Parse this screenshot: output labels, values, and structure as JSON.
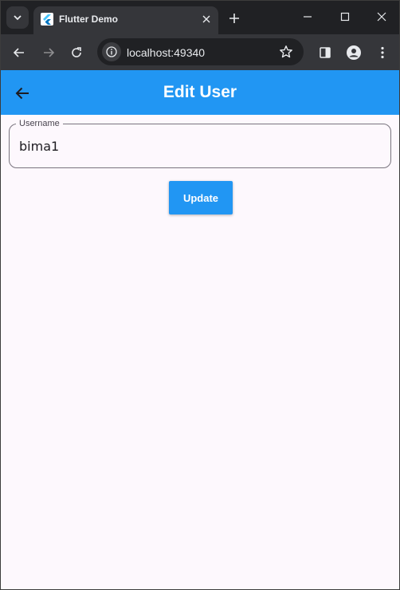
{
  "browser": {
    "tab_title": "Flutter Demo",
    "url": "localhost:49340"
  },
  "icons": {
    "tab_search": "chevron-down-icon",
    "favicon": "flutter-logo-icon",
    "tab_close": "close-icon",
    "new_tab": "plus-icon",
    "minimize": "minimize-icon",
    "maximize": "maximize-icon",
    "window_close": "close-icon",
    "nav_back": "arrow-left-icon",
    "nav_forward": "arrow-right-icon",
    "reload": "reload-icon",
    "site_info": "info-icon",
    "bookmark": "star-icon",
    "side_panel": "side-panel-icon",
    "profile": "account-icon",
    "menu": "more-vert-icon",
    "appbar_back": "arrow-back-icon"
  },
  "appbar": {
    "title": "Edit User"
  },
  "form": {
    "username_label": "Username",
    "username_value": "bima1",
    "update_label": "Update"
  },
  "colors": {
    "primary": "#2196f3",
    "page_background": "#fdf8fd",
    "browser_frame": "#202124",
    "toolbar": "#35363a"
  }
}
